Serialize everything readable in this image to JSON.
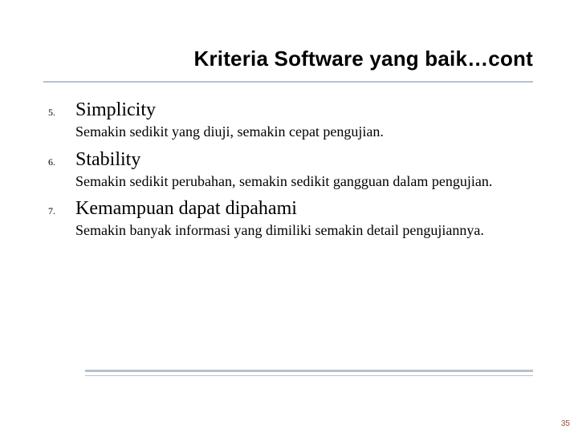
{
  "title": "Kriteria Software yang baik…cont",
  "items": [
    {
      "num": "5.",
      "heading": "Simplicity",
      "desc": "Semakin sedikit yang diuji, semakin cepat pengujian."
    },
    {
      "num": "6.",
      "heading": "Stability",
      "desc": "Semakin sedikit perubahan, semakin sedikit gangguan dalam pengujian."
    },
    {
      "num": "7.",
      "heading": "Kemampuan dapat dipahami",
      "desc": "Semakin banyak informasi yang dimiliki semakin detail pengujiannya."
    }
  ],
  "page_number": "35"
}
